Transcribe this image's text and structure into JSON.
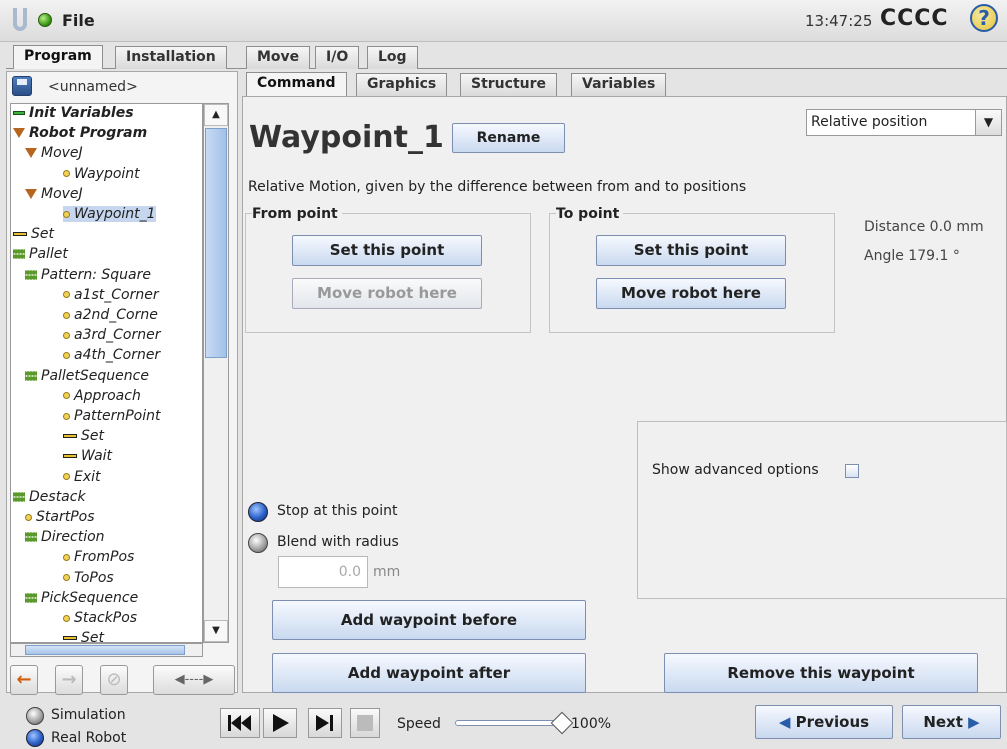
{
  "topbar": {
    "file_label": "File",
    "time": "13:47:25",
    "robot_name": "CCCC",
    "help_symbol": "?"
  },
  "main_tabs": [
    "Program",
    "Installation",
    "Move",
    "I/O",
    "Log"
  ],
  "sub_tabs": [
    "Command",
    "Graphics",
    "Structure",
    "Variables"
  ],
  "program_name": "<unnamed>",
  "tree": [
    {
      "label": "Init Variables",
      "style": "b",
      "marker": "init"
    },
    {
      "label": "Robot Program",
      "style": "bi",
      "marker": "tri"
    },
    {
      "label": "MoveJ",
      "style": "i",
      "marker": "tri"
    },
    {
      "label": "Waypoint",
      "style": "i",
      "marker": "way"
    },
    {
      "label": "MoveJ",
      "style": "i",
      "marker": "tri"
    },
    {
      "label": "Waypoint_1",
      "style": "i",
      "marker": "way",
      "selected": true
    },
    {
      "label": "Set",
      "style": "i",
      "marker": "set"
    },
    {
      "label": "Pallet",
      "style": "i",
      "marker": "pal"
    },
    {
      "label": "Pattern: Square",
      "style": "i",
      "marker": "pal"
    },
    {
      "label": "a1st_Corner",
      "style": "i",
      "marker": "way"
    },
    {
      "label": "a2nd_Corne",
      "style": "i",
      "marker": "way"
    },
    {
      "label": "a3rd_Corner",
      "style": "i",
      "marker": "way"
    },
    {
      "label": "a4th_Corner",
      "style": "i",
      "marker": "way"
    },
    {
      "label": "PalletSequence",
      "style": "i",
      "marker": "pal"
    },
    {
      "label": "Approach",
      "style": "i",
      "marker": "way"
    },
    {
      "label": "PatternPoint",
      "style": "i",
      "marker": "way"
    },
    {
      "label": "Set",
      "style": "i",
      "marker": "set"
    },
    {
      "label": "Wait",
      "style": "i",
      "marker": "set"
    },
    {
      "label": "Exit",
      "style": "i",
      "marker": "way"
    },
    {
      "label": "Destack",
      "style": "i",
      "marker": "pal"
    },
    {
      "label": "StartPos",
      "style": "i",
      "marker": "way"
    },
    {
      "label": "Direction",
      "style": "i",
      "marker": "pal"
    },
    {
      "label": "FromPos",
      "style": "i",
      "marker": "way"
    },
    {
      "label": "ToPos",
      "style": "i",
      "marker": "way"
    },
    {
      "label": "PickSequence",
      "style": "i",
      "marker": "pal"
    },
    {
      "label": "StackPos",
      "style": "i",
      "marker": "way"
    },
    {
      "label": "Set",
      "style": "i",
      "marker": "set"
    }
  ],
  "left_toolbar": {
    "undo": "←",
    "redo": "→",
    "delete": "⊘",
    "move": "◀----▶"
  },
  "waypoint": {
    "title": "Waypoint_1",
    "rename_label": "Rename",
    "position_mode": "Relative position",
    "description": "Relative Motion, given by the difference between from and to positions",
    "from_label": "From point",
    "to_label": "To point",
    "set_point_label": "Set this point",
    "move_here_label": "Move robot here",
    "distance": "Distance 0.0 mm",
    "angle": "Angle 179.1 °",
    "stop_label": "Stop at this point",
    "blend_label": "Blend with radius",
    "blend_value": "0.0",
    "blend_unit": "mm",
    "advanced_label": "Show advanced options",
    "add_before_label": "Add waypoint before",
    "add_after_label": "Add waypoint after",
    "remove_label": "Remove this waypoint"
  },
  "bottom": {
    "simulation_label": "Simulation",
    "real_robot_label": "Real Robot",
    "speed_label": "Speed",
    "speed_value": "100%",
    "previous_label": "Previous",
    "next_label": "Next"
  }
}
